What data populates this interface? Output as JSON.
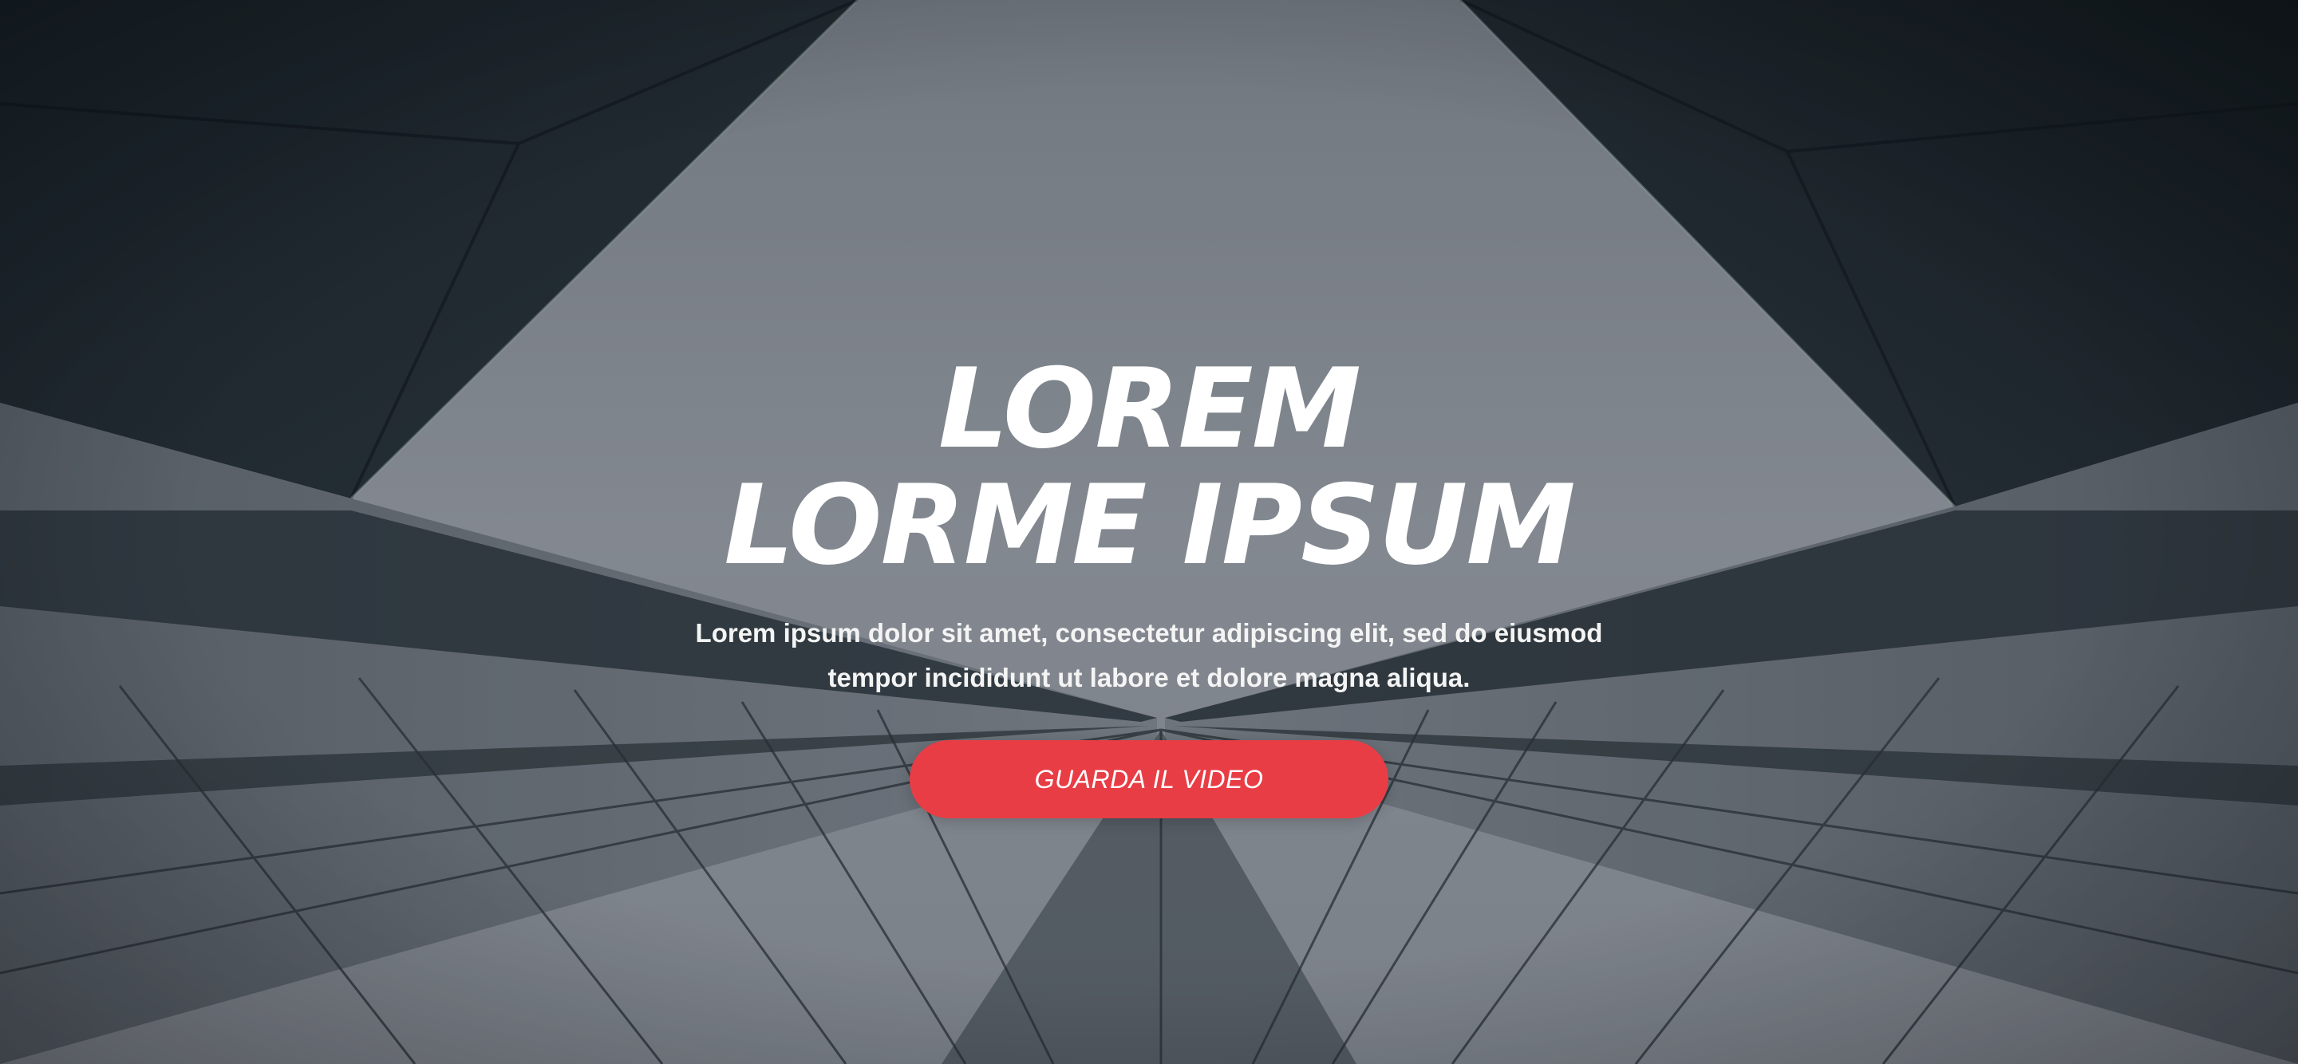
{
  "hero": {
    "headline_line1": "LOREM",
    "headline_line2": "LORME IPSUM",
    "subtitle_line1": "Lorem ipsum dolor sit amet, consectetur adipiscing elit, sed do eiusmod",
    "subtitle_line2": "tempor incididunt ut labore et dolore magna aliqua.",
    "cta_label": "GUARDA IL VIDEO"
  },
  "colors": {
    "cta_background": "#e83d45",
    "text": "#ffffff",
    "sky": "#8a9099",
    "building_dark": "#1e262c"
  }
}
